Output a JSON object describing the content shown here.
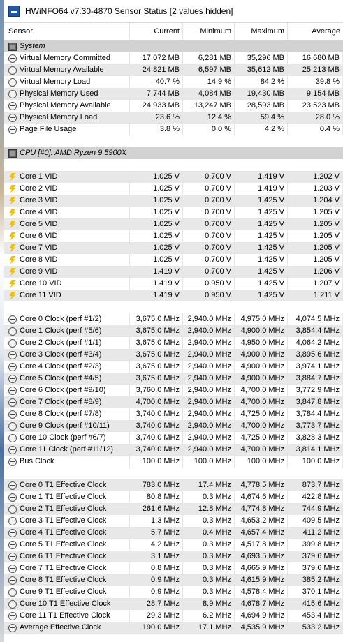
{
  "window": {
    "title": "HWiNFO64 v7.30-4870 Sensor Status [2 values hidden]"
  },
  "header": [
    "Sensor",
    "Current",
    "Minimum",
    "Maximum",
    "Average"
  ],
  "rows": [
    {
      "type": "group",
      "icon": "chip-icon",
      "label": "System"
    },
    {
      "type": "data",
      "icon": "clock",
      "label": "Virtual Memory Committed",
      "values": [
        "17,072 MB",
        "6,281 MB",
        "35,296 MB",
        "16,680 MB"
      ]
    },
    {
      "type": "data",
      "icon": "clock",
      "label": "Virtual Memory Available",
      "values": [
        "24,821 MB",
        "6,597 MB",
        "35,612 MB",
        "25,213 MB"
      ]
    },
    {
      "type": "data",
      "icon": "clock",
      "label": "Virtual Memory Load",
      "values": [
        "40.7 %",
        "14.9 %",
        "84.2 %",
        "39.8 %"
      ]
    },
    {
      "type": "data",
      "icon": "clock",
      "label": "Physical Memory Used",
      "values": [
        "7,744 MB",
        "4,084 MB",
        "19,430 MB",
        "9,154 MB"
      ]
    },
    {
      "type": "data",
      "icon": "clock",
      "label": "Physical Memory Available",
      "values": [
        "24,933 MB",
        "13,247 MB",
        "28,593 MB",
        "23,523 MB"
      ]
    },
    {
      "type": "data",
      "icon": "clock",
      "label": "Physical Memory Load",
      "values": [
        "23.6 %",
        "12.4 %",
        "59.4 %",
        "28.0 %"
      ]
    },
    {
      "type": "data",
      "icon": "clock",
      "label": "Page File Usage",
      "values": [
        "3.8 %",
        "0.0 %",
        "4.2 %",
        "0.4 %"
      ]
    },
    {
      "type": "blank"
    },
    {
      "type": "group",
      "icon": "chip-icon",
      "label": "CPU [#0]: AMD Ryzen 9 5900X"
    },
    {
      "type": "blank"
    },
    {
      "type": "data",
      "icon": "volt",
      "label": "Core 1 VID",
      "values": [
        "1.025 V",
        "0.700 V",
        "1.419 V",
        "1.202 V"
      ]
    },
    {
      "type": "data",
      "icon": "volt",
      "label": "Core 2 VID",
      "values": [
        "1.025 V",
        "0.700 V",
        "1.419 V",
        "1.203 V"
      ]
    },
    {
      "type": "data",
      "icon": "volt",
      "label": "Core 3 VID",
      "values": [
        "1.025 V",
        "0.700 V",
        "1.425 V",
        "1.204 V"
      ]
    },
    {
      "type": "data",
      "icon": "volt",
      "label": "Core 4 VID",
      "values": [
        "1.025 V",
        "0.700 V",
        "1.425 V",
        "1.205 V"
      ]
    },
    {
      "type": "data",
      "icon": "volt",
      "label": "Core 5 VID",
      "values": [
        "1.025 V",
        "0.700 V",
        "1.425 V",
        "1.205 V"
      ]
    },
    {
      "type": "data",
      "icon": "volt",
      "label": "Core 6 VID",
      "values": [
        "1.025 V",
        "0.700 V",
        "1.425 V",
        "1.205 V"
      ]
    },
    {
      "type": "data",
      "icon": "volt",
      "label": "Core 7 VID",
      "values": [
        "1.025 V",
        "0.700 V",
        "1.425 V",
        "1.205 V"
      ]
    },
    {
      "type": "data",
      "icon": "volt",
      "label": "Core 8 VID",
      "values": [
        "1.025 V",
        "0.700 V",
        "1.425 V",
        "1.205 V"
      ]
    },
    {
      "type": "data",
      "icon": "volt",
      "label": "Core 9 VID",
      "values": [
        "1.419 V",
        "0.700 V",
        "1.425 V",
        "1.206 V"
      ]
    },
    {
      "type": "data",
      "icon": "volt",
      "label": "Core 10 VID",
      "values": [
        "1.419 V",
        "0.950 V",
        "1.425 V",
        "1.207 V"
      ]
    },
    {
      "type": "data",
      "icon": "volt",
      "label": "Core 11 VID",
      "values": [
        "1.419 V",
        "0.950 V",
        "1.425 V",
        "1.211 V"
      ]
    },
    {
      "type": "blank"
    },
    {
      "type": "data",
      "icon": "clock",
      "label": "Core 0 Clock (perf #1/2)",
      "values": [
        "3,675.0 MHz",
        "2,940.0 MHz",
        "4,975.0 MHz",
        "4,074.5 MHz"
      ]
    },
    {
      "type": "data",
      "icon": "clock",
      "label": "Core 1 Clock (perf #5/6)",
      "values": [
        "3,675.0 MHz",
        "2,940.0 MHz",
        "4,900.0 MHz",
        "3,854.4 MHz"
      ]
    },
    {
      "type": "data",
      "icon": "clock",
      "label": "Core 2 Clock (perf #1/1)",
      "values": [
        "3,675.0 MHz",
        "2,940.0 MHz",
        "4,950.0 MHz",
        "4,064.2 MHz"
      ]
    },
    {
      "type": "data",
      "icon": "clock",
      "label": "Core 3 Clock (perf #3/4)",
      "values": [
        "3,675.0 MHz",
        "2,940.0 MHz",
        "4,900.0 MHz",
        "3,895.6 MHz"
      ]
    },
    {
      "type": "data",
      "icon": "clock",
      "label": "Core 4 Clock (perf #2/3)",
      "values": [
        "3,675.0 MHz",
        "2,940.0 MHz",
        "4,900.0 MHz",
        "3,974.1 MHz"
      ]
    },
    {
      "type": "data",
      "icon": "clock",
      "label": "Core 5 Clock (perf #4/5)",
      "values": [
        "3,675.0 MHz",
        "2,940.0 MHz",
        "4,900.0 MHz",
        "3,884.7 MHz"
      ]
    },
    {
      "type": "data",
      "icon": "clock",
      "label": "Core 6 Clock (perf #9/10)",
      "values": [
        "3,760.0 MHz",
        "2,940.0 MHz",
        "4,700.0 MHz",
        "3,772.9 MHz"
      ]
    },
    {
      "type": "data",
      "icon": "clock",
      "label": "Core 7 Clock (perf #8/9)",
      "values": [
        "4,700.0 MHz",
        "2,940.0 MHz",
        "4,700.0 MHz",
        "3,847.8 MHz"
      ]
    },
    {
      "type": "data",
      "icon": "clock",
      "label": "Core 8 Clock (perf #7/8)",
      "values": [
        "3,740.0 MHz",
        "2,940.0 MHz",
        "4,725.0 MHz",
        "3,784.4 MHz"
      ]
    },
    {
      "type": "data",
      "icon": "clock",
      "label": "Core 9 Clock (perf #10/11)",
      "values": [
        "3,740.0 MHz",
        "2,940.0 MHz",
        "4,700.0 MHz",
        "3,773.7 MHz"
      ]
    },
    {
      "type": "data",
      "icon": "clock",
      "label": "Core 10 Clock (perf #6/7)",
      "values": [
        "3,740.0 MHz",
        "2,940.0 MHz",
        "4,725.0 MHz",
        "3,828.3 MHz"
      ]
    },
    {
      "type": "data",
      "icon": "clock",
      "label": "Core 11 Clock (perf #11/12)",
      "values": [
        "3,740.0 MHz",
        "2,940.0 MHz",
        "4,700.0 MHz",
        "3,814.1 MHz"
      ]
    },
    {
      "type": "data",
      "icon": "clock",
      "label": "Bus Clock",
      "values": [
        "100.0 MHz",
        "100.0 MHz",
        "100.0 MHz",
        "100.0 MHz"
      ]
    },
    {
      "type": "blank"
    },
    {
      "type": "data",
      "icon": "clock",
      "label": "Core 0 T1 Effective Clock",
      "values": [
        "783.0 MHz",
        "17.4 MHz",
        "4,778.5 MHz",
        "873.7 MHz"
      ]
    },
    {
      "type": "data",
      "icon": "clock",
      "label": "Core 1 T1 Effective Clock",
      "values": [
        "80.8 MHz",
        "0.3 MHz",
        "4,674.6 MHz",
        "422.8 MHz"
      ]
    },
    {
      "type": "data",
      "icon": "clock",
      "label": "Core 2 T1 Effective Clock",
      "values": [
        "261.6 MHz",
        "12.8 MHz",
        "4,774.8 MHz",
        "744.9 MHz"
      ]
    },
    {
      "type": "data",
      "icon": "clock",
      "label": "Core 3 T1 Effective Clock",
      "values": [
        "1.3 MHz",
        "0.3 MHz",
        "4,653.2 MHz",
        "409.5 MHz"
      ]
    },
    {
      "type": "data",
      "icon": "clock",
      "label": "Core 4 T1 Effective Clock",
      "values": [
        "5.7 MHz",
        "0.4 MHz",
        "4,657.4 MHz",
        "411.2 MHz"
      ]
    },
    {
      "type": "data",
      "icon": "clock",
      "label": "Core 5 T1 Effective Clock",
      "values": [
        "4.2 MHz",
        "0.3 MHz",
        "4,517.8 MHz",
        "399.8 MHz"
      ]
    },
    {
      "type": "data",
      "icon": "clock",
      "label": "Core 6 T1 Effective Clock",
      "values": [
        "3.1 MHz",
        "0.3 MHz",
        "4,693.5 MHz",
        "379.6 MHz"
      ]
    },
    {
      "type": "data",
      "icon": "clock",
      "label": "Core 7 T1 Effective Clock",
      "values": [
        "0.8 MHz",
        "0.3 MHz",
        "4,665.9 MHz",
        "379.6 MHz"
      ]
    },
    {
      "type": "data",
      "icon": "clock",
      "label": "Core 8 T1 Effective Clock",
      "values": [
        "0.9 MHz",
        "0.3 MHz",
        "4,615.9 MHz",
        "385.2 MHz"
      ]
    },
    {
      "type": "data",
      "icon": "clock",
      "label": "Core 9 T1 Effective Clock",
      "values": [
        "0.9 MHz",
        "0.3 MHz",
        "4,578.4 MHz",
        "370.1 MHz"
      ]
    },
    {
      "type": "data",
      "icon": "clock",
      "label": "Core 10 T1 Effective Clock",
      "values": [
        "28.7 MHz",
        "8.9 MHz",
        "4,678.7 MHz",
        "415.6 MHz"
      ]
    },
    {
      "type": "data",
      "icon": "clock",
      "label": "Core 11 T1 Effective Clock",
      "values": [
        "29.3 MHz",
        "6.2 MHz",
        "4,694.9 MHz",
        "453.4 MHz"
      ]
    },
    {
      "type": "data",
      "icon": "clock",
      "label": "Average Effective Clock",
      "values": [
        "190.0 MHz",
        "17.1 MHz",
        "4,535.9 MHz",
        "533.2 MHz"
      ]
    }
  ]
}
